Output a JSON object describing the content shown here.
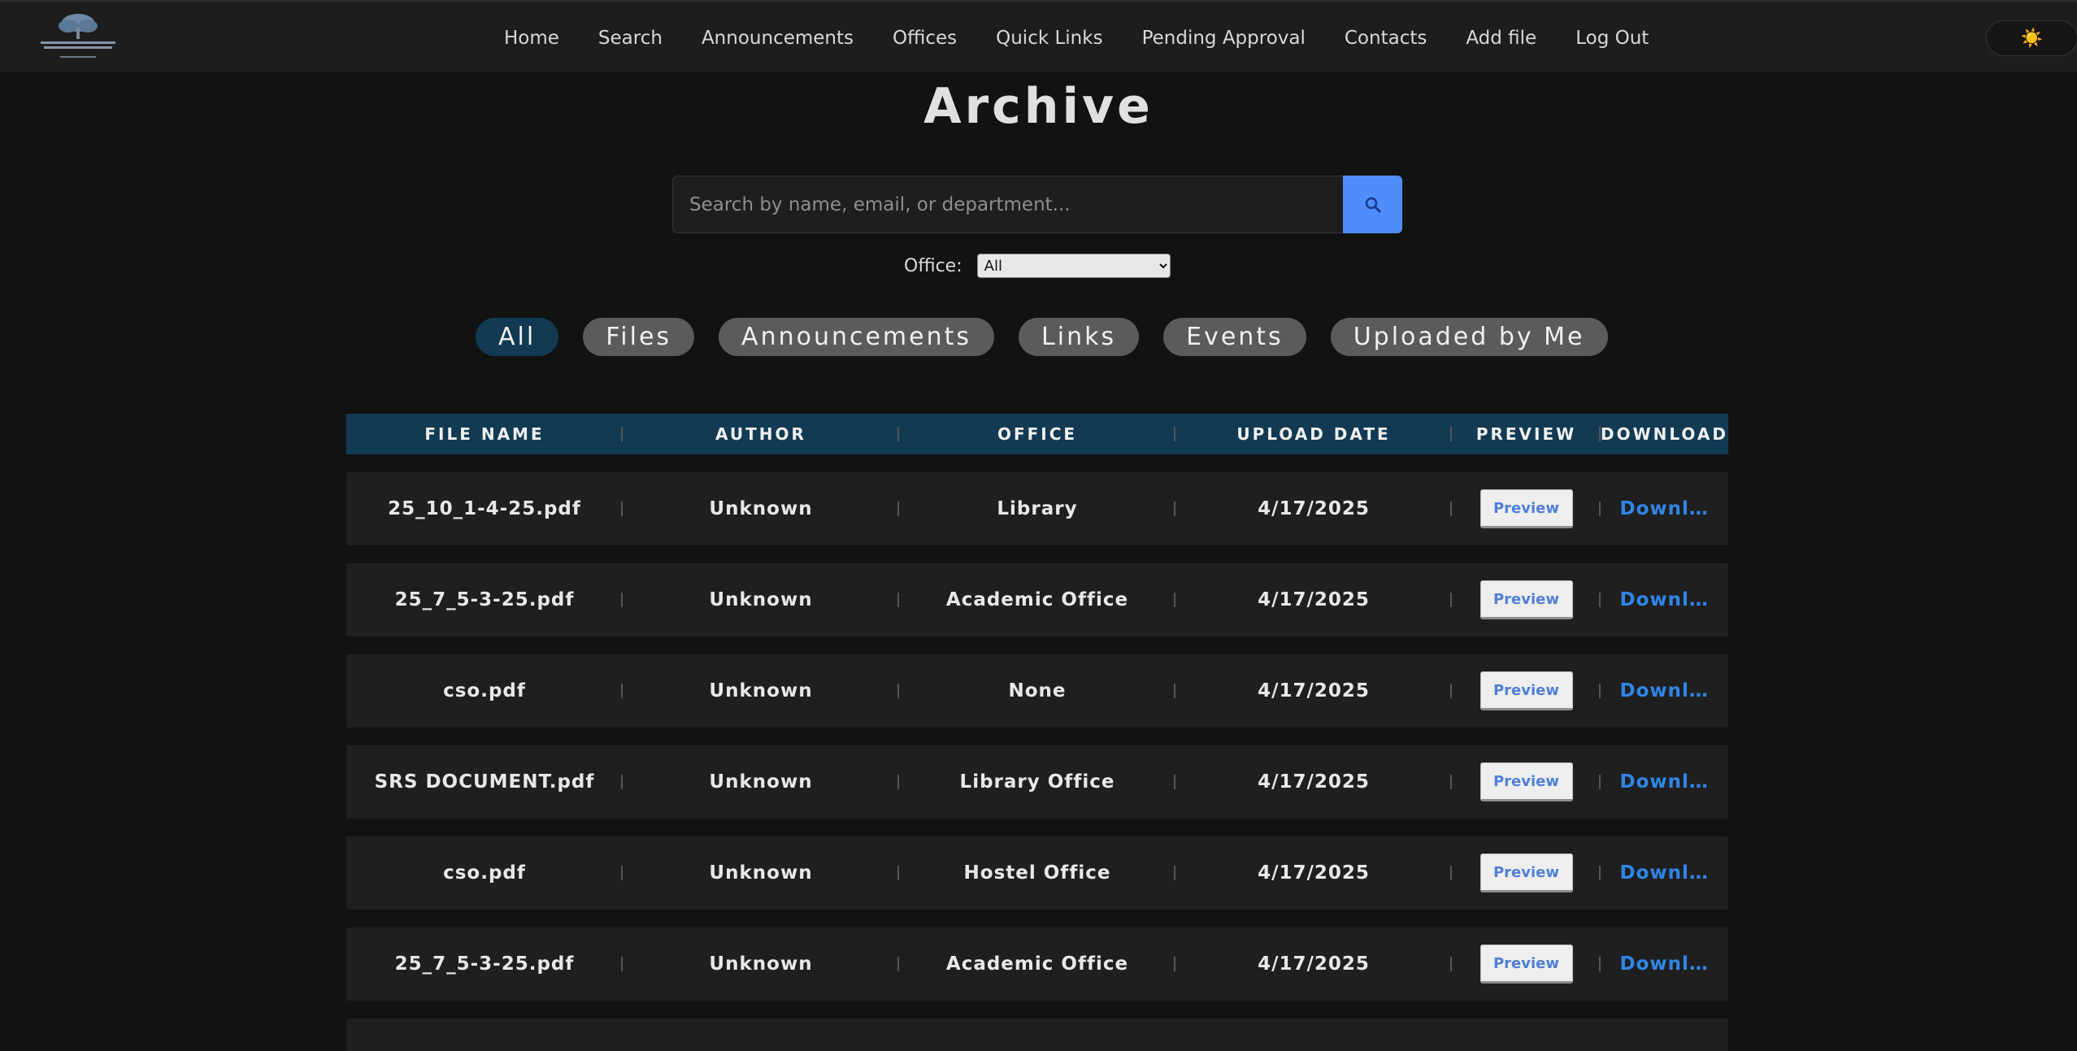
{
  "nav": {
    "logo_alt": "INTERNATIONAL INSTITUTE OF INFORMATION TECHNOLOGY HYDERABAD",
    "links": [
      "Home",
      "Search",
      "Announcements",
      "Offices",
      "Quick Links",
      "Pending Approval",
      "Contacts",
      "Add file",
      "Log Out"
    ],
    "theme_icon": "sun-icon",
    "theme_glyph": "☀️"
  },
  "page": {
    "title": "Archive"
  },
  "search": {
    "placeholder": "Search by name, email, or department...",
    "value": "",
    "button_icon": "search-icon"
  },
  "office_filter": {
    "label": "Office:",
    "selected": "All"
  },
  "filters": {
    "active": "All",
    "items": [
      "All",
      "Files",
      "Announcements",
      "Links",
      "Events",
      "Uploaded by Me"
    ]
  },
  "table": {
    "headers": [
      "FILE NAME",
      "AUTHOR",
      "OFFICE",
      "UPLOAD DATE",
      "PREVIEW",
      "DOWNLOAD"
    ],
    "preview_label": "Preview",
    "download_label": "Download",
    "rows": [
      {
        "file_name": "25_10_1-4-25.pdf",
        "author": "Unknown",
        "office": "Library",
        "upload_date": "4/17/2025"
      },
      {
        "file_name": "25_7_5-3-25.pdf",
        "author": "Unknown",
        "office": "Academic Office",
        "upload_date": "4/17/2025"
      },
      {
        "file_name": "cso.pdf",
        "author": "Unknown",
        "office": "None",
        "upload_date": "4/17/2025"
      },
      {
        "file_name": "SRS DOCUMENT.pdf",
        "author": "Unknown",
        "office": "Library Office",
        "upload_date": "4/17/2025"
      },
      {
        "file_name": "cso.pdf",
        "author": "Unknown",
        "office": "Hostel Office",
        "upload_date": "4/17/2025"
      },
      {
        "file_name": "25_7_5-3-25.pdf",
        "author": "Unknown",
        "office": "Academic Office",
        "upload_date": "4/17/2025"
      }
    ]
  },
  "colors": {
    "background": "#121212",
    "navbar": "#1d1d1d",
    "accent_header": "#123a52",
    "search_button": "#4f8dfd",
    "download_link": "#2f86e8"
  }
}
